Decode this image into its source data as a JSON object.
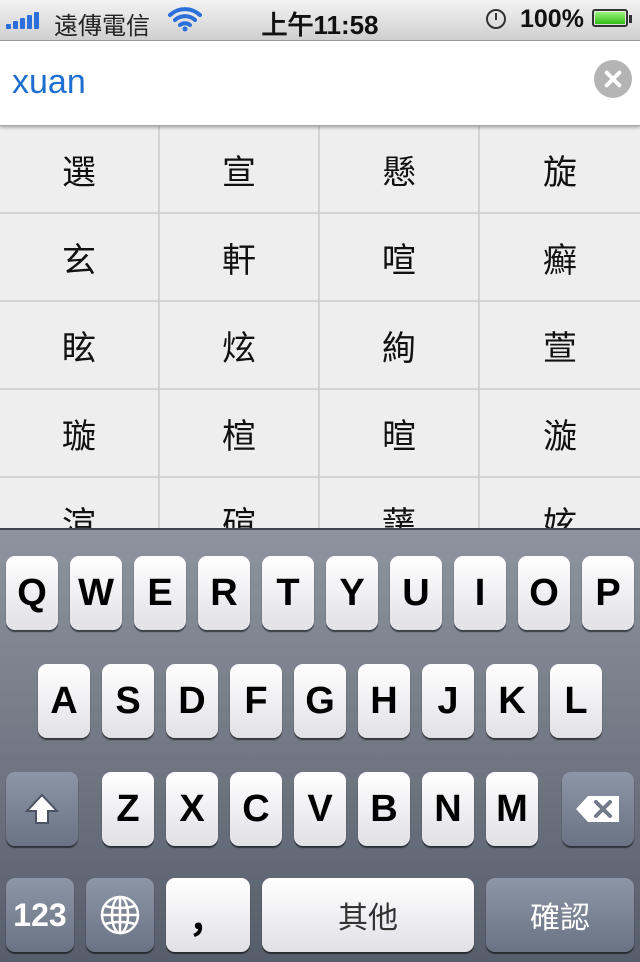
{
  "status_bar": {
    "carrier": "遠傳電信",
    "time": "上午11:58",
    "battery_percent": "100%",
    "battery_level": 1.0
  },
  "input": {
    "pinyin": "xuan"
  },
  "candidates": [
    "選",
    "宣",
    "懸",
    "旋",
    "玄",
    "軒",
    "喧",
    "癬",
    "眩",
    "炫",
    "絢",
    "萱",
    "璇",
    "楦",
    "暄",
    "漩",
    "渲",
    "碹",
    "蘐",
    "妶"
  ],
  "keyboard": {
    "row1": [
      "Q",
      "W",
      "E",
      "R",
      "T",
      "Y",
      "U",
      "I",
      "O",
      "P"
    ],
    "row2": [
      "A",
      "S",
      "D",
      "F",
      "G",
      "H",
      "J",
      "K",
      "L"
    ],
    "row3": [
      "Z",
      "X",
      "C",
      "V",
      "B",
      "N",
      "M"
    ],
    "numbers_label": "123",
    "comma_label": "，",
    "space_label": "其他",
    "confirm_label": "確認"
  }
}
